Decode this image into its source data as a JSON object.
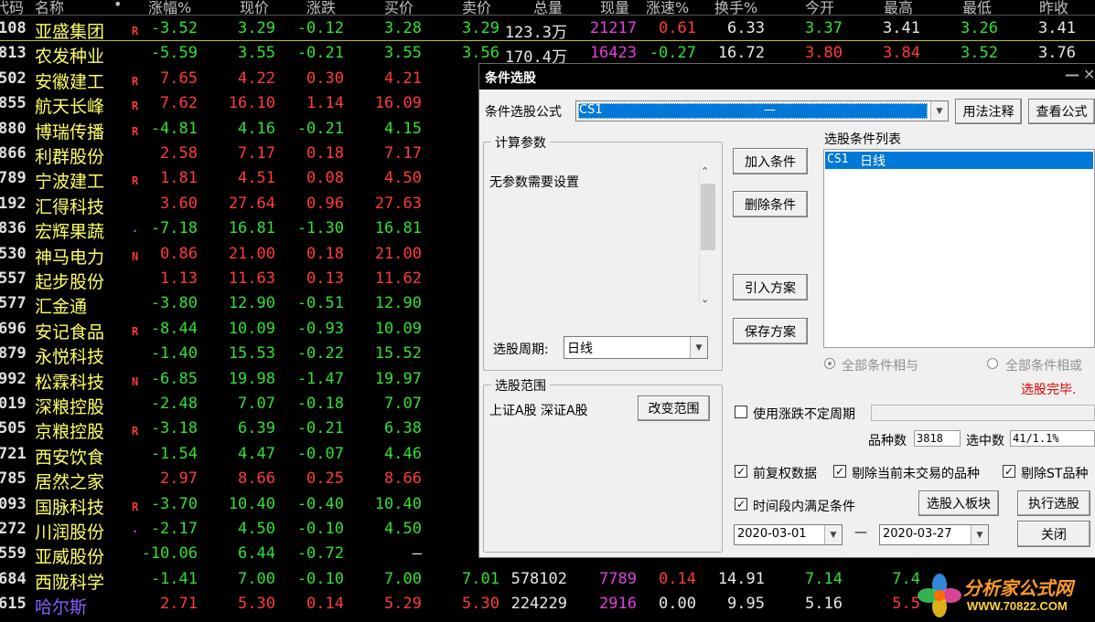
{
  "columns": [
    "代码",
    "名称",
    "•",
    "涨幅%",
    "现价",
    "涨跌",
    "买价",
    "卖价",
    "总量",
    "现量",
    "涨速%",
    "换手%",
    "今开",
    "最高",
    "最低",
    "昨收"
  ],
  "rows": [
    {
      "code": "108",
      "name": "亚盛集团",
      "flag": "R",
      "chg_pct": "-3.52",
      "price": "3.29",
      "change": "-0.12",
      "bid": "3.28",
      "ask": "3.29",
      "volume": "123.3万",
      "cur_vol": "21217",
      "speed": "0.61",
      "turnover": "6.33",
      "open": "3.37",
      "high": "3.41",
      "low": "3.26",
      "prev": "3.41"
    },
    {
      "code": "813",
      "name": "农发种业",
      "flag": "",
      "chg_pct": "-5.59",
      "price": "3.55",
      "change": "-0.21",
      "bid": "3.55",
      "ask": "3.56",
      "volume": "170.4万",
      "cur_vol": "16423",
      "speed": "-0.27",
      "turnover": "16.72",
      "open": "3.80",
      "high": "3.84",
      "low": "3.52",
      "prev": "3.76"
    },
    {
      "code": "502",
      "name": "安徽建工",
      "flag": "R",
      "chg_pct": "7.65",
      "price": "4.22",
      "change": "0.30",
      "bid": "4.21",
      "ask": "4"
    },
    {
      "code": "855",
      "name": "航天长峰",
      "flag": "R",
      "chg_pct": "7.62",
      "price": "16.10",
      "change": "1.14",
      "bid": "16.09",
      "ask": "16"
    },
    {
      "code": "880",
      "name": "博瑞传播",
      "flag": "R",
      "chg_pct": "-4.81",
      "price": "4.16",
      "change": "-0.21",
      "bid": "4.15",
      "ask": "4"
    },
    {
      "code": "866",
      "name": "利群股份",
      "flag": "",
      "chg_pct": "2.58",
      "price": "7.17",
      "change": "0.18",
      "bid": "7.17",
      "ask": "7"
    },
    {
      "code": "789",
      "name": "宁波建工",
      "flag": "R",
      "chg_pct": "1.81",
      "price": "4.51",
      "change": "0.08",
      "bid": "4.50",
      "ask": "4"
    },
    {
      "code": "192",
      "name": "汇得科技",
      "flag": "",
      "chg_pct": "3.60",
      "price": "27.64",
      "change": "0.96",
      "bid": "27.63",
      "ask": "27"
    },
    {
      "code": "836",
      "name": "宏辉果蔬",
      "flag": "·",
      "chg_pct": "-7.18",
      "price": "16.81",
      "change": "-1.30",
      "bid": "16.81",
      "ask": "16"
    },
    {
      "code": "530",
      "name": "神马电力",
      "flag": "N",
      "chg_pct": "0.86",
      "price": "21.00",
      "change": "0.18",
      "bid": "21.00",
      "ask": "21"
    },
    {
      "code": "557",
      "name": "起步股份",
      "flag": "",
      "chg_pct": "1.13",
      "price": "11.63",
      "change": "0.13",
      "bid": "11.62",
      "ask": "11"
    },
    {
      "code": "577",
      "name": "汇金通",
      "flag": "",
      "chg_pct": "-3.80",
      "price": "12.90",
      "change": "-0.51",
      "bid": "12.90",
      "ask": "12"
    },
    {
      "code": "696",
      "name": "安记食品",
      "flag": "R",
      "chg_pct": "-8.44",
      "price": "10.09",
      "change": "-0.93",
      "bid": "10.09",
      "ask": "10"
    },
    {
      "code": "879",
      "name": "永悦科技",
      "flag": "",
      "chg_pct": "-1.40",
      "price": "15.53",
      "change": "-0.22",
      "bid": "15.52",
      "ask": "15"
    },
    {
      "code": "992",
      "name": "松霖科技",
      "flag": "N",
      "chg_pct": "-6.85",
      "price": "19.98",
      "change": "-1.47",
      "bid": "19.97",
      "ask": "19"
    },
    {
      "code": "019",
      "name": "深粮控股",
      "flag": "",
      "chg_pct": "-2.48",
      "price": "7.07",
      "change": "-0.18",
      "bid": "7.07",
      "ask": "7"
    },
    {
      "code": "505",
      "name": "京粮控股",
      "flag": "R",
      "chg_pct": "-3.18",
      "price": "6.39",
      "change": "-0.21",
      "bid": "6.38",
      "ask": "6"
    },
    {
      "code": "721",
      "name": "西安饮食",
      "flag": "",
      "chg_pct": "-1.54",
      "price": "4.47",
      "change": "-0.07",
      "bid": "4.46",
      "ask": "4"
    },
    {
      "code": "785",
      "name": "居然之家",
      "flag": "",
      "chg_pct": "2.97",
      "price": "8.66",
      "change": "0.25",
      "bid": "8.66",
      "ask": "8"
    },
    {
      "code": "093",
      "name": "国脉科技",
      "flag": "R",
      "chg_pct": "-3.70",
      "price": "10.40",
      "change": "-0.40",
      "bid": "10.40",
      "ask": "10"
    },
    {
      "code": "272",
      "name": "川润股份",
      "flag": "·",
      "chg_pct": "-2.17",
      "price": "4.50",
      "change": "-0.10",
      "bid": "4.50",
      "ask": "4"
    },
    {
      "code": "559",
      "name": "亚威股份",
      "flag": "",
      "chg_pct": "-10.06",
      "price": "6.44",
      "change": "-0.72",
      "bid": "—",
      "ask": "6"
    },
    {
      "code": "684",
      "name": "西陇科学",
      "flag": "",
      "chg_pct": "-1.41",
      "price": "7.00",
      "change": "-0.10",
      "bid": "7.00",
      "ask": "7.01",
      "volume": "578102",
      "cur_vol": "7789",
      "speed": "0.14",
      "turnover": "14.91",
      "open": "7.14",
      "high": "7.4"
    },
    {
      "code": "615",
      "name": "哈尔斯",
      "flag": "",
      "chg_pct": "2.71",
      "price": "5.30",
      "change": "0.14",
      "bid": "5.29",
      "ask": "5.30",
      "volume": "224229",
      "cur_vol": "2916",
      "speed": "0.00",
      "turnover": "9.95",
      "open": "5.16",
      "high": "5.5"
    }
  ],
  "colors": {
    "up": "#ff3c3c",
    "down": "#34e034",
    "flat": "#e8e8e8",
    "name": "#ffff66",
    "cur_vol": "#e040e0",
    "accent": "#0078d7"
  },
  "dialog": {
    "title": "条件选股",
    "minimize_glyph": "—",
    "close_glyph": "✕",
    "formula_label": "条件选股公式",
    "formula_value": "CS1",
    "formula_value_suffix": "—",
    "usage_button": "用法注释",
    "view_formula_button": "查看公式",
    "params_group": "计算参数",
    "params_text": "无参数需要设置",
    "period_label": "选股周期:",
    "period_value": "日线",
    "range_group": "选股范围",
    "range_value": "上证A股 深证A股",
    "change_range_button": "改变范围",
    "add_button": "加入条件",
    "delete_button": "删除条件",
    "import_button": "引入方案",
    "save_button": "保存方案",
    "condition_list_label": "选股条件列表",
    "conditions": [
      {
        "code": "CS1",
        "period": "日线"
      }
    ],
    "radio_and": "全部条件相与",
    "radio_or": "全部条件相或",
    "status": "选股完毕.",
    "variable_period_label": "使用涨跌不定周期",
    "count_label": "品种数",
    "count_value": "3818",
    "selected_label": "选中数",
    "selected_value": "41/1.1%",
    "pre_adjust_label": "前复权数据",
    "exclude_untraded_label": "剔除当前未交易的品种",
    "exclude_st_label": "剔除ST品种",
    "period_condition_label": "时间段内满足条件",
    "to_block_button": "选股入板块",
    "execute_button": "执行选股",
    "date_from": "2020-03-01",
    "date_sep": "—",
    "date_to": "2020-03-27",
    "close_button": "关闭"
  },
  "watermark": {
    "text": "分析家公式网",
    "url": "WWW.70822.COM"
  }
}
